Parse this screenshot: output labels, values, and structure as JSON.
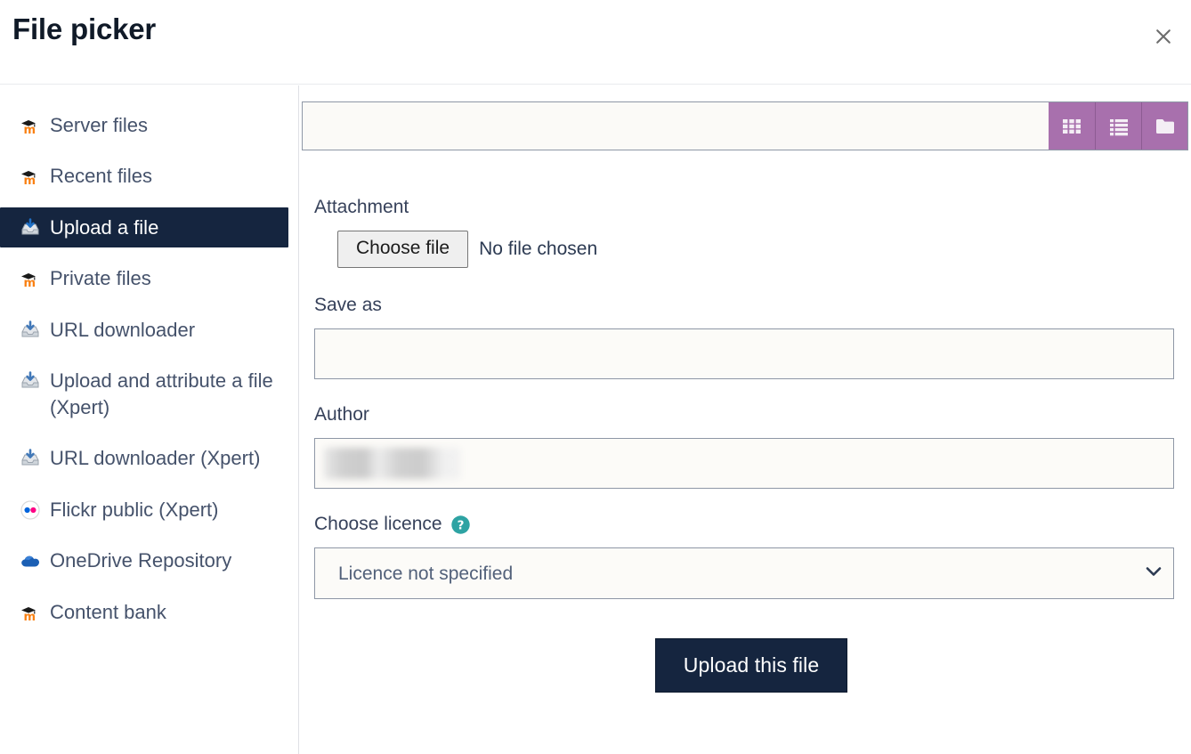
{
  "header": {
    "title": "File picker",
    "close_icon": "close-icon"
  },
  "sidebar": {
    "items": [
      {
        "label": "Server files",
        "icon": "moodle-m-icon",
        "active": false
      },
      {
        "label": "Recent files",
        "icon": "moodle-m-icon",
        "active": false
      },
      {
        "label": "Upload a file",
        "icon": "upload-tray-icon",
        "active": true
      },
      {
        "label": "Private files",
        "icon": "moodle-m-icon",
        "active": false
      },
      {
        "label": "URL downloader",
        "icon": "download-tray-icon",
        "active": false
      },
      {
        "label": "Upload and attribute a file (Xpert)",
        "icon": "download-tray-icon",
        "active": false
      },
      {
        "label": "URL downloader (Xpert)",
        "icon": "download-tray-icon",
        "active": false
      },
      {
        "label": "Flickr public (Xpert)",
        "icon": "flickr-icon",
        "active": false
      },
      {
        "label": "OneDrive Repository",
        "icon": "onedrive-cloud-icon",
        "active": false
      },
      {
        "label": "Content bank",
        "icon": "moodle-m-icon",
        "active": false
      }
    ]
  },
  "toolbar": {
    "view_buttons": [
      {
        "name": "grid-view-button",
        "icon": "grid-icon"
      },
      {
        "name": "list-view-button",
        "icon": "list-icon"
      },
      {
        "name": "tree-view-button",
        "icon": "folder-icon"
      }
    ]
  },
  "form": {
    "attachment_label": "Attachment",
    "choose_file_label": "Choose file",
    "no_file_text": "No file chosen",
    "save_as_label": "Save as",
    "save_as_value": "",
    "save_as_placeholder": "",
    "author_label": "Author",
    "author_value": "",
    "author_placeholder": "",
    "author_redacted": true,
    "licence_label": "Choose licence",
    "licence_help_icon": "help-circle-icon",
    "licence_selected": "Licence not specified",
    "licence_options": [
      "Licence not specified"
    ],
    "submit_label": "Upload this file"
  },
  "colors": {
    "accent_dark": "#15253f",
    "toolbar_purple": "#a870ad",
    "help_teal": "#2ea3a3",
    "moodle_orange": "#f98012",
    "text_body": "#45526b"
  }
}
